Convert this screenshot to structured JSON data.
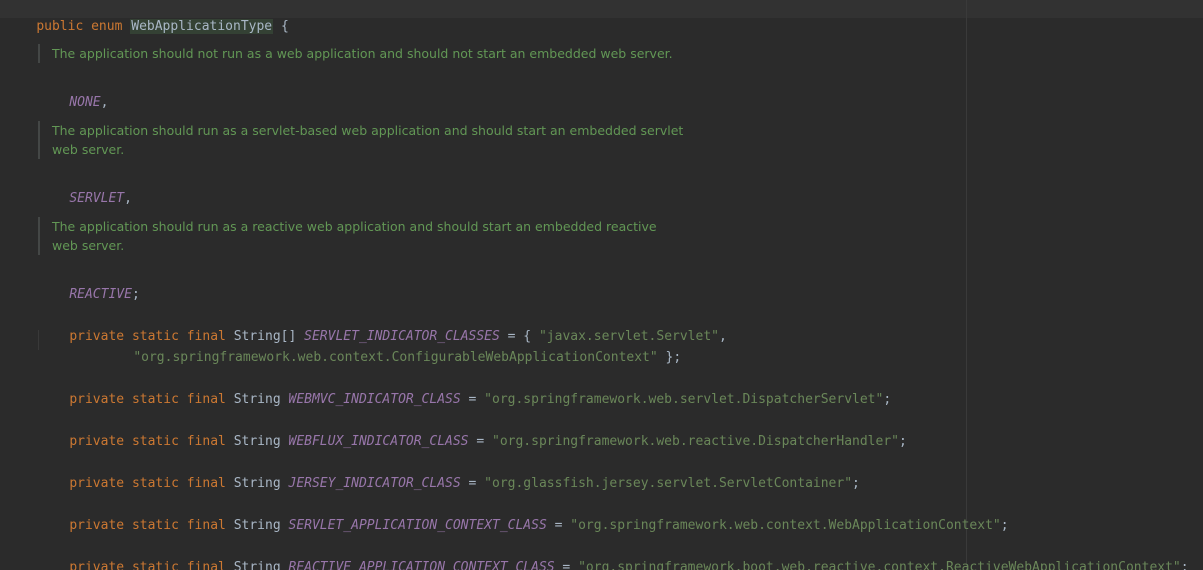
{
  "header": {
    "kw_public": "public",
    "kw_enum": "enum",
    "class_name": "WebApplicationType",
    "brace": "{"
  },
  "docs": [
    [
      "The application should not run as a web application and should not start an embedded web server."
    ],
    [
      "The application should run as a servlet-based web application and should start an embedded servlet",
      "web server."
    ],
    [
      "The application should run as a reactive web application and should start an embedded reactive",
      "web server."
    ]
  ],
  "enums": [
    {
      "name": "NONE",
      "punct": ","
    },
    {
      "name": "SERVLET",
      "punct": ","
    },
    {
      "name": "REACTIVE",
      "punct": ";"
    }
  ],
  "modifiers": {
    "private": "private",
    "static": "static",
    "final": "final"
  },
  "fields": [
    {
      "type": "String[]",
      "name": "SERVLET_INDICATOR_CLASSES",
      "assign": " = { ",
      "value": "\"javax.servlet.Servlet\"",
      "end": ",",
      "continuation_value": "\"org.springframework.web.context.ConfigurableWebApplicationContext\"",
      "continuation_end": " };"
    },
    {
      "type": "String",
      "name": "WEBMVC_INDICATOR_CLASS",
      "assign": " = ",
      "value": "\"org.springframework.web.servlet.DispatcherServlet\"",
      "end": ";"
    },
    {
      "type": "String",
      "name": "WEBFLUX_INDICATOR_CLASS",
      "assign": " = ",
      "value": "\"org.springframework.web.reactive.DispatcherHandler\"",
      "end": ";"
    },
    {
      "type": "String",
      "name": "JERSEY_INDICATOR_CLASS",
      "assign": " = ",
      "value": "\"org.glassfish.jersey.servlet.ServletContainer\"",
      "end": ";"
    },
    {
      "type": "String",
      "name": "SERVLET_APPLICATION_CONTEXT_CLASS",
      "assign": " = ",
      "value": "\"org.springframework.web.context.WebApplicationContext\"",
      "end": ";"
    },
    {
      "type": "String",
      "name": "REACTIVE_APPLICATION_CONTEXT_CLASS",
      "assign": " = ",
      "value": "\"org.springframework.boot.web.reactive.context.ReactiveWebApplicationContext\"",
      "end": ";"
    }
  ],
  "colors": {
    "background": "#2b2b2b",
    "keyword": "#cc7832",
    "constant": "#9876aa",
    "string": "#6a8759",
    "doc": "#629755",
    "text": "#a9b7c6"
  }
}
